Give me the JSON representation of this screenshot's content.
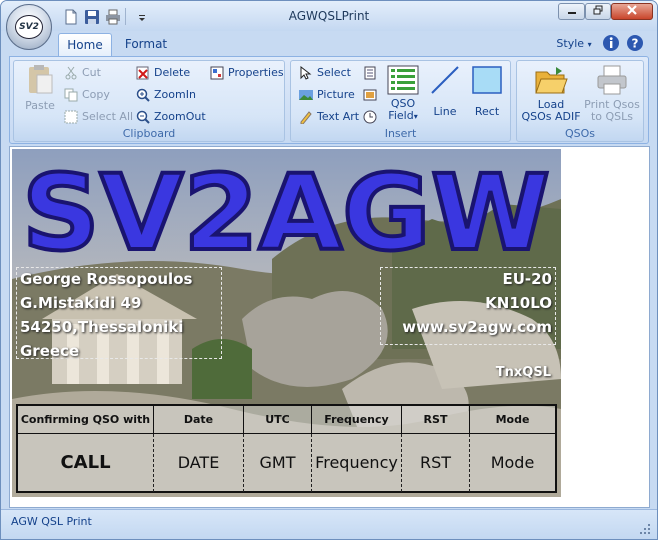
{
  "window": {
    "title": "AGWQSLPrint",
    "app_button_label": "SV2"
  },
  "tabs": [
    {
      "label": "Home",
      "active": true
    },
    {
      "label": "Format",
      "active": false
    }
  ],
  "style_menu": {
    "label": "Style"
  },
  "clipboard": {
    "label": "Clipboard",
    "paste": "Paste",
    "cut": "Cut",
    "copy": "Copy",
    "select_all": "Select All",
    "delete": "Delete",
    "zoom_in": "ZoomIn",
    "zoom_out": "ZoomOut",
    "properties": "Properties"
  },
  "insert": {
    "label": "Insert",
    "select": "Select",
    "picture": "Picture",
    "text_art": "Text Art",
    "qso_field_1": "QSO",
    "qso_field_2": "Field",
    "line": "Line",
    "rect": "Rect"
  },
  "qsos": {
    "label": "QSOs",
    "load_1": "Load",
    "load_2": "QSOs ADIF",
    "print_1": "Print Qsos",
    "print_2": "to QSLs"
  },
  "card": {
    "callsign": "SV2AGW",
    "address": [
      "George Rossopoulos",
      "G.Mistakidi 49",
      "54250,Thessaloniki",
      "Greece"
    ],
    "info": [
      "EU-20",
      "KN10LO",
      "www.sv2agw.com"
    ],
    "tnx": "TnxQSL",
    "table": {
      "headers": [
        "Confirming QSO with",
        "Date",
        "UTC",
        "Frequency",
        "RST",
        "Mode"
      ],
      "values": [
        "CALL",
        "DATE",
        "GMT",
        "Frequency",
        "RST",
        "Mode"
      ]
    }
  },
  "status": {
    "text": "AGW QSL Print"
  },
  "colors": {
    "ribbon_text": "#15428b",
    "callsign_fill": "#3a37e0",
    "callsign_outline": "#1a1470"
  }
}
